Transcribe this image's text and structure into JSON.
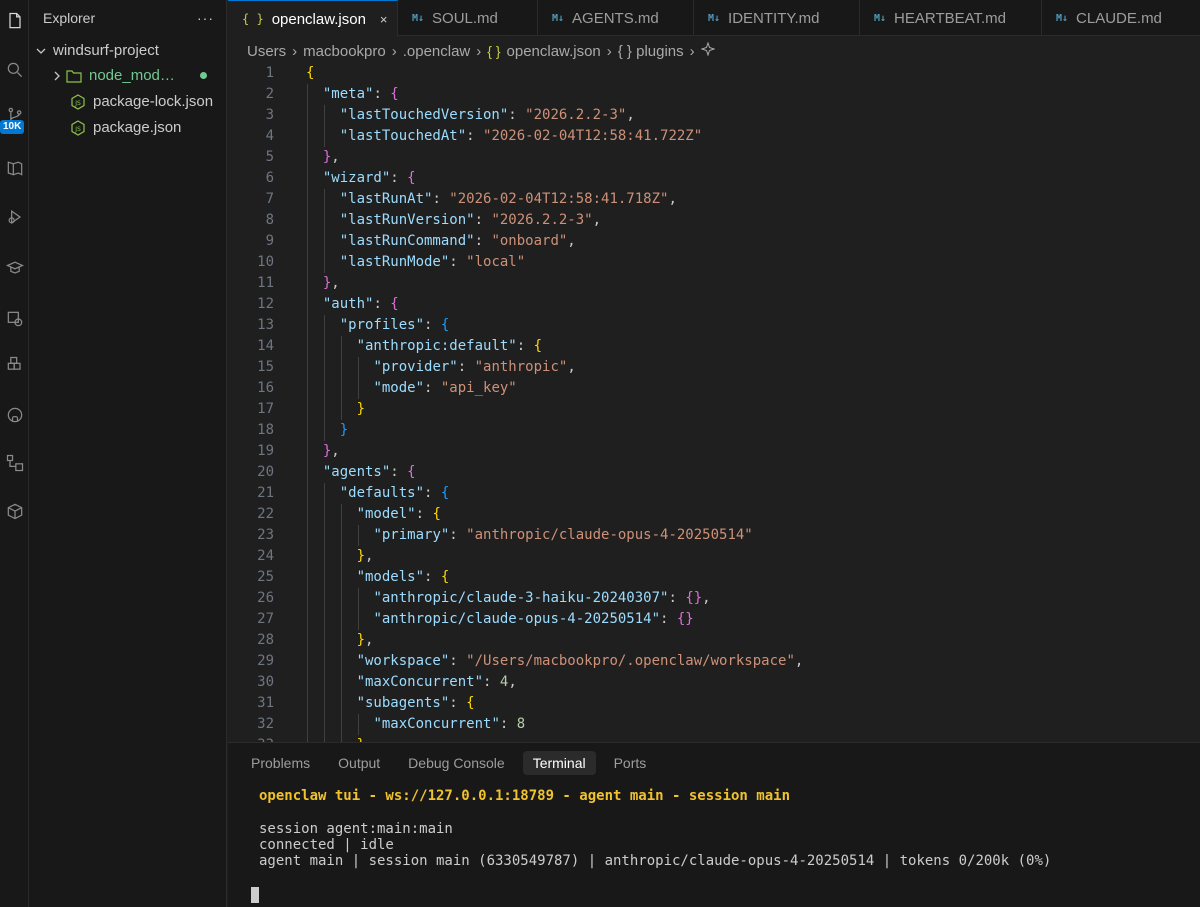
{
  "sidebar": {
    "title": "Explorer",
    "more": "···",
    "project": "windsurf-project",
    "items": [
      {
        "label": "node_mod…",
        "type": "folder",
        "modified": true
      },
      {
        "label": "package-lock.json",
        "type": "file",
        "icon": "node-js-icon"
      },
      {
        "label": "package.json",
        "type": "file",
        "icon": "node-js-icon"
      }
    ]
  },
  "activity": {
    "badge": "10K",
    "icons": [
      "files-icon",
      "search-icon",
      "source-control-icon",
      "book-icon",
      "run-debug-icon",
      "extensions-icon",
      "remote-icon",
      "puzzle-icon",
      "github-icon",
      "diagram-icon",
      "package-icon"
    ]
  },
  "tabs": [
    {
      "label": "openclaw.json",
      "icon": "{ }",
      "active": true,
      "close": "×"
    },
    {
      "label": "SOUL.md",
      "icon": "M↓"
    },
    {
      "label": "AGENTS.md",
      "icon": "M↓"
    },
    {
      "label": "IDENTITY.md",
      "icon": "M↓"
    },
    {
      "label": "HEARTBEAT.md",
      "icon": "M↓"
    },
    {
      "label": "CLAUDE.md",
      "icon": "M↓"
    }
  ],
  "breadcrumb": {
    "parts": [
      "Users",
      "macbookpro",
      ".openclaw",
      "openclaw.json",
      "{ } plugins"
    ],
    "json_icon": "{ }"
  },
  "editor": {
    "lines": [
      {
        "n": "1",
        "i": 0,
        "t": [
          [
            "b1",
            "{"
          ]
        ]
      },
      {
        "n": "2",
        "i": 1,
        "t": [
          [
            "k",
            "\"meta\""
          ],
          [
            "p",
            ": "
          ],
          [
            "b2",
            "{"
          ]
        ]
      },
      {
        "n": "3",
        "i": 2,
        "t": [
          [
            "k",
            "\"lastTouchedVersion\""
          ],
          [
            "p",
            ": "
          ],
          [
            "s",
            "\"2026.2.2-3\""
          ],
          [
            "p",
            ","
          ]
        ]
      },
      {
        "n": "4",
        "i": 2,
        "t": [
          [
            "k",
            "\"lastTouchedAt\""
          ],
          [
            "p",
            ": "
          ],
          [
            "s",
            "\"2026-02-04T12:58:41.722Z\""
          ]
        ]
      },
      {
        "n": "5",
        "i": 1,
        "t": [
          [
            "b2",
            "}"
          ],
          [
            "p",
            ","
          ]
        ]
      },
      {
        "n": "6",
        "i": 1,
        "t": [
          [
            "k",
            "\"wizard\""
          ],
          [
            "p",
            ": "
          ],
          [
            "b2",
            "{"
          ]
        ]
      },
      {
        "n": "7",
        "i": 2,
        "t": [
          [
            "k",
            "\"lastRunAt\""
          ],
          [
            "p",
            ": "
          ],
          [
            "s",
            "\"2026-02-04T12:58:41.718Z\""
          ],
          [
            "p",
            ","
          ]
        ]
      },
      {
        "n": "8",
        "i": 2,
        "t": [
          [
            "k",
            "\"lastRunVersion\""
          ],
          [
            "p",
            ": "
          ],
          [
            "s",
            "\"2026.2.2-3\""
          ],
          [
            "p",
            ","
          ]
        ]
      },
      {
        "n": "9",
        "i": 2,
        "t": [
          [
            "k",
            "\"lastRunCommand\""
          ],
          [
            "p",
            ": "
          ],
          [
            "s",
            "\"onboard\""
          ],
          [
            "p",
            ","
          ]
        ]
      },
      {
        "n": "10",
        "i": 2,
        "t": [
          [
            "k",
            "\"lastRunMode\""
          ],
          [
            "p",
            ": "
          ],
          [
            "s",
            "\"local\""
          ]
        ]
      },
      {
        "n": "11",
        "i": 1,
        "t": [
          [
            "b2",
            "}"
          ],
          [
            "p",
            ","
          ]
        ]
      },
      {
        "n": "12",
        "i": 1,
        "t": [
          [
            "k",
            "\"auth\""
          ],
          [
            "p",
            ": "
          ],
          [
            "b2",
            "{"
          ]
        ]
      },
      {
        "n": "13",
        "i": 2,
        "t": [
          [
            "k",
            "\"profiles\""
          ],
          [
            "p",
            ": "
          ],
          [
            "b3",
            "{"
          ]
        ]
      },
      {
        "n": "14",
        "i": 3,
        "t": [
          [
            "k",
            "\"anthropic:default\""
          ],
          [
            "p",
            ": "
          ],
          [
            "b1",
            "{"
          ]
        ]
      },
      {
        "n": "15",
        "i": 4,
        "t": [
          [
            "k",
            "\"provider\""
          ],
          [
            "p",
            ": "
          ],
          [
            "s",
            "\"anthropic\""
          ],
          [
            "p",
            ","
          ]
        ]
      },
      {
        "n": "16",
        "i": 4,
        "t": [
          [
            "k",
            "\"mode\""
          ],
          [
            "p",
            ": "
          ],
          [
            "s",
            "\"api_key\""
          ]
        ]
      },
      {
        "n": "17",
        "i": 3,
        "t": [
          [
            "b1",
            "}"
          ]
        ]
      },
      {
        "n": "18",
        "i": 2,
        "t": [
          [
            "b3",
            "}"
          ]
        ]
      },
      {
        "n": "19",
        "i": 1,
        "t": [
          [
            "b2",
            "}"
          ],
          [
            "p",
            ","
          ]
        ]
      },
      {
        "n": "20",
        "i": 1,
        "t": [
          [
            "k",
            "\"agents\""
          ],
          [
            "p",
            ": "
          ],
          [
            "b2",
            "{"
          ]
        ]
      },
      {
        "n": "21",
        "i": 2,
        "t": [
          [
            "k",
            "\"defaults\""
          ],
          [
            "p",
            ": "
          ],
          [
            "b3",
            "{"
          ]
        ]
      },
      {
        "n": "22",
        "i": 3,
        "t": [
          [
            "k",
            "\"model\""
          ],
          [
            "p",
            ": "
          ],
          [
            "b1",
            "{"
          ]
        ]
      },
      {
        "n": "23",
        "i": 4,
        "t": [
          [
            "k",
            "\"primary\""
          ],
          [
            "p",
            ": "
          ],
          [
            "s",
            "\"anthropic/claude-opus-4-20250514\""
          ]
        ]
      },
      {
        "n": "24",
        "i": 3,
        "t": [
          [
            "b1",
            "}"
          ],
          [
            "p",
            ","
          ]
        ]
      },
      {
        "n": "25",
        "i": 3,
        "t": [
          [
            "k",
            "\"models\""
          ],
          [
            "p",
            ": "
          ],
          [
            "b1",
            "{"
          ]
        ]
      },
      {
        "n": "26",
        "i": 4,
        "t": [
          [
            "k",
            "\"anthropic/claude-3-haiku-20240307\""
          ],
          [
            "p",
            ": "
          ],
          [
            "b2",
            "{}"
          ],
          [
            "p",
            ","
          ]
        ]
      },
      {
        "n": "27",
        "i": 4,
        "t": [
          [
            "k",
            "\"anthropic/claude-opus-4-20250514\""
          ],
          [
            "p",
            ": "
          ],
          [
            "b2",
            "{}"
          ]
        ]
      },
      {
        "n": "28",
        "i": 3,
        "t": [
          [
            "b1",
            "}"
          ],
          [
            "p",
            ","
          ]
        ]
      },
      {
        "n": "29",
        "i": 3,
        "t": [
          [
            "k",
            "\"workspace\""
          ],
          [
            "p",
            ": "
          ],
          [
            "s",
            "\"/Users/macbookpro/.openclaw/workspace\""
          ],
          [
            "p",
            ","
          ]
        ]
      },
      {
        "n": "30",
        "i": 3,
        "t": [
          [
            "k",
            "\"maxConcurrent\""
          ],
          [
            "p",
            ": "
          ],
          [
            "n",
            "4"
          ],
          [
            "p",
            ","
          ]
        ]
      },
      {
        "n": "31",
        "i": 3,
        "t": [
          [
            "k",
            "\"subagents\""
          ],
          [
            "p",
            ": "
          ],
          [
            "b1",
            "{"
          ]
        ]
      },
      {
        "n": "32",
        "i": 4,
        "t": [
          [
            "k",
            "\"maxConcurrent\""
          ],
          [
            "p",
            ": "
          ],
          [
            "n",
            "8"
          ]
        ]
      },
      {
        "n": "33",
        "i": 3,
        "t": [
          [
            "b1",
            "}"
          ]
        ]
      }
    ]
  },
  "panel": {
    "tabs": [
      "Problems",
      "Output",
      "Debug Console",
      "Terminal",
      "Ports"
    ],
    "active_tab": "Terminal",
    "terminal": {
      "title": "openclaw tui - ws://127.0.0.1:18789 - agent main - session main",
      "line1": "session agent:main:main",
      "line2": "connected | idle",
      "line3": "agent main | session main (6330549787) | anthropic/claude-opus-4-20250514 | tokens 0/200k (0%)"
    }
  }
}
